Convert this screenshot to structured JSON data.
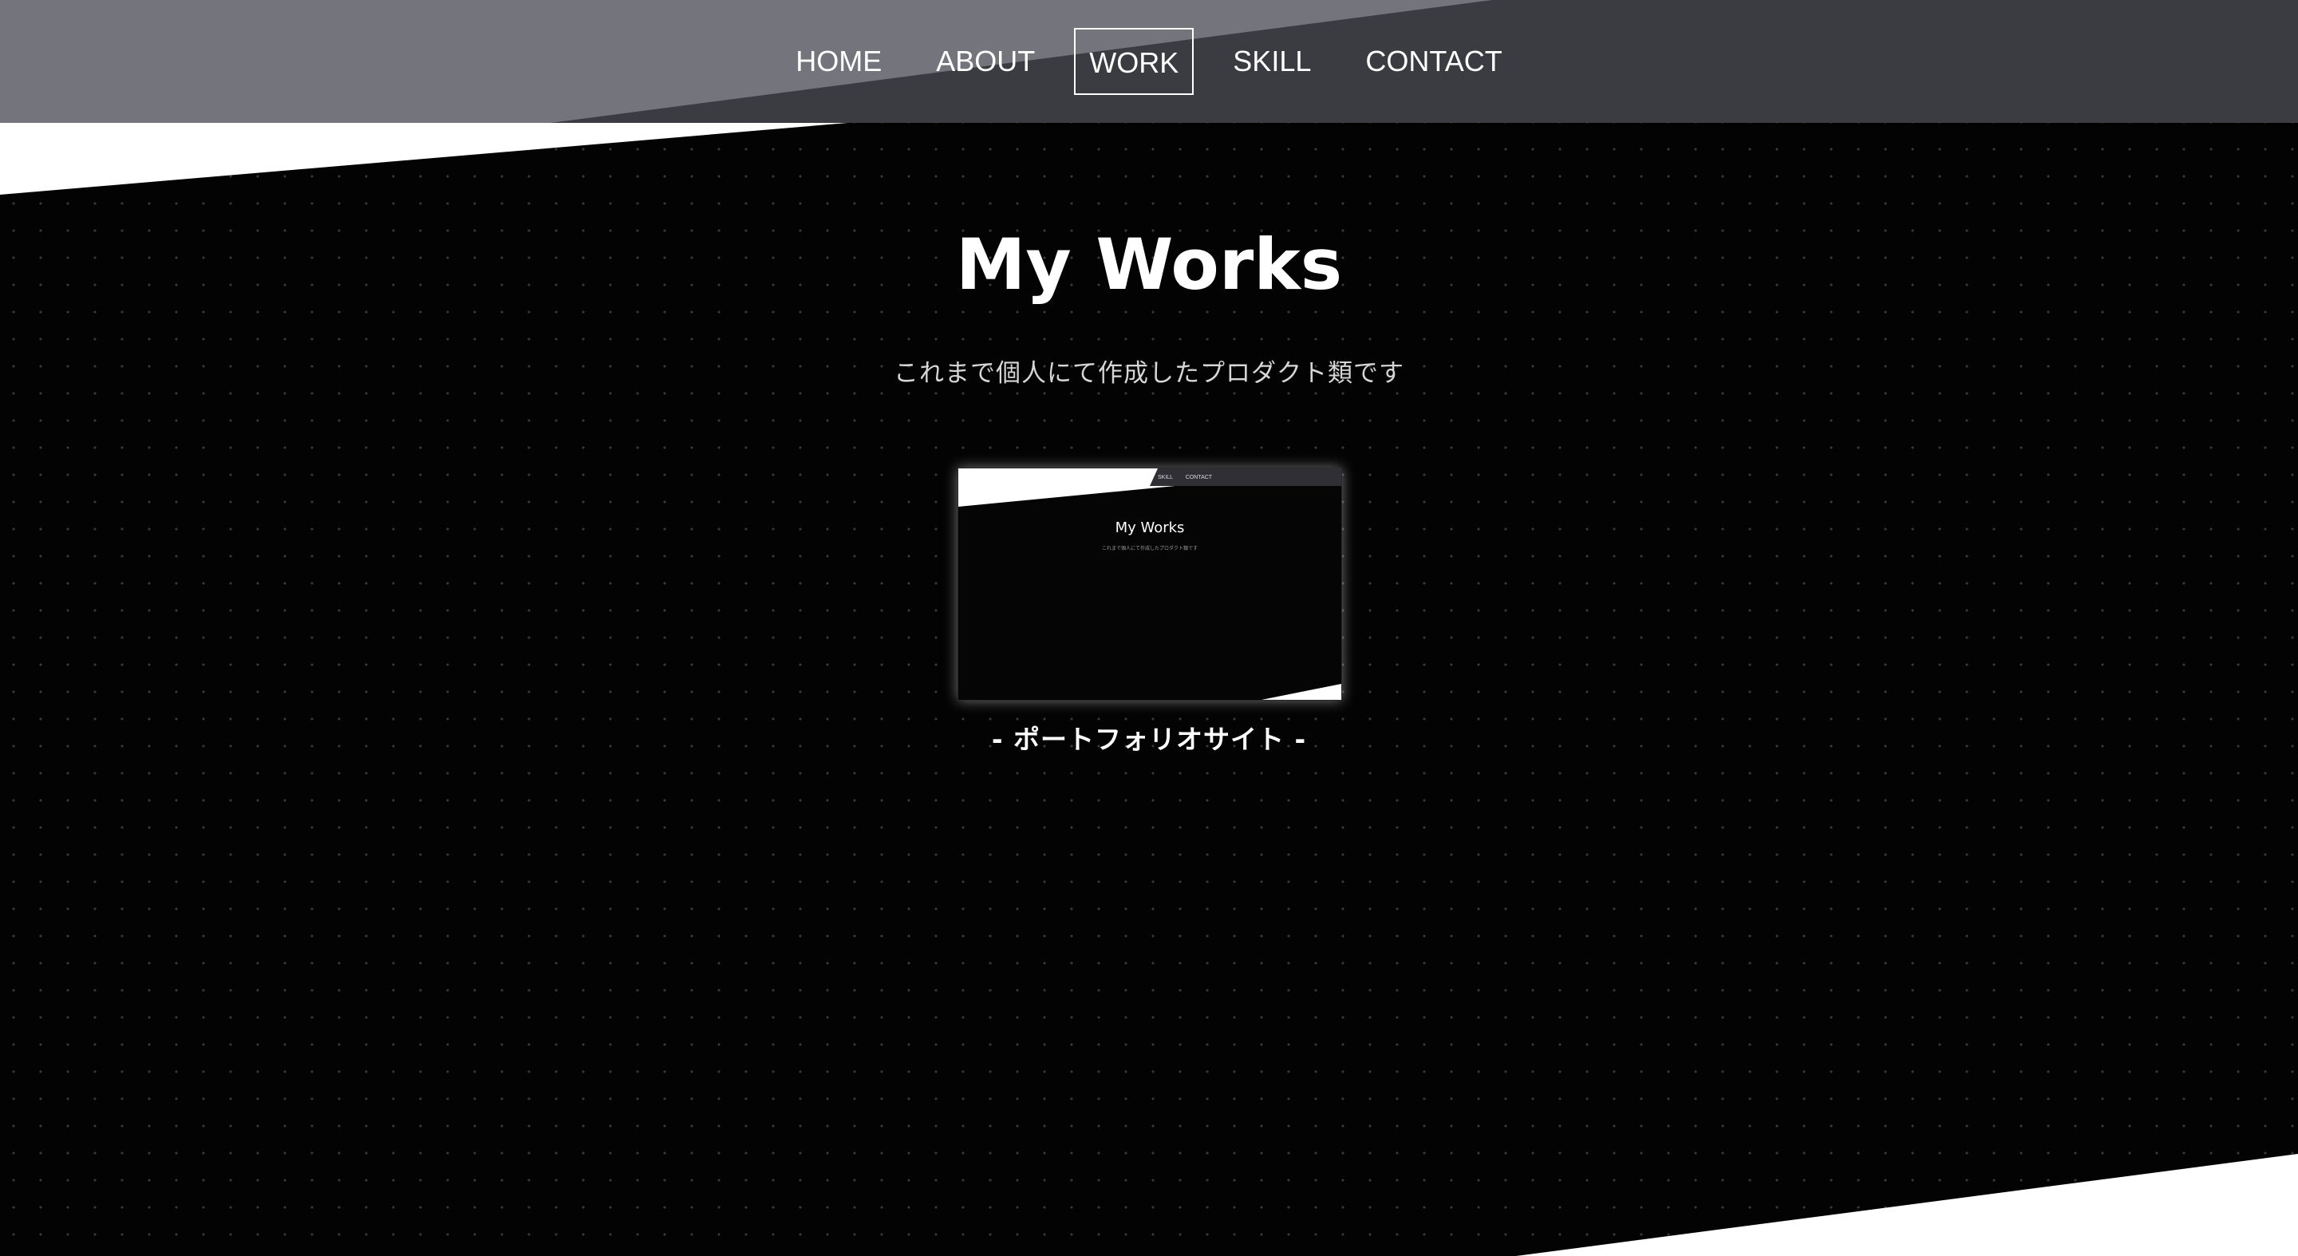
{
  "nav": {
    "items": [
      {
        "label": "HOME",
        "active": false
      },
      {
        "label": "ABOUT",
        "active": false
      },
      {
        "label": "WORK",
        "active": true
      },
      {
        "label": "SKILL",
        "active": false
      },
      {
        "label": "CONTACT",
        "active": false
      }
    ]
  },
  "main": {
    "title": "My Works",
    "subtitle": "これまで個人にて作成したプロダクト類です",
    "works": [
      {
        "caption": "- ポートフォリオサイト -",
        "thumbnail": {
          "nav_text": "SKILL  CONTACT",
          "title": "My Works",
          "subtitle": "これまで個人にて作成したプロダクト類です"
        }
      }
    ]
  },
  "colors": {
    "header_dark": "#3b3b42",
    "header_light": "#74747d",
    "section_bg": "#030303",
    "text": "#ffffff",
    "subtitle_text": "#d6d6d6"
  }
}
